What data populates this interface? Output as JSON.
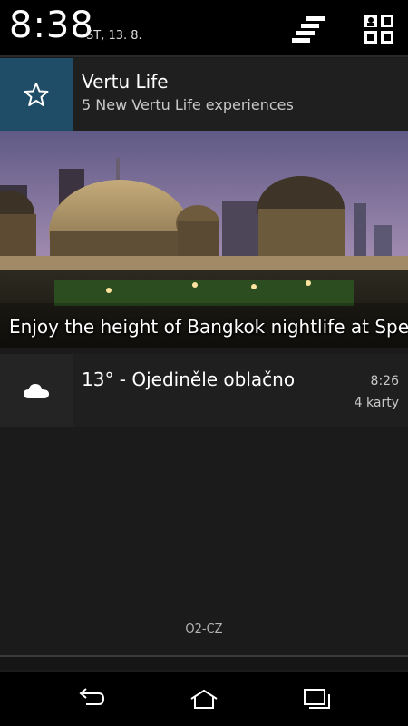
{
  "status": {
    "time": "8:38",
    "date": "ST, 13. 8."
  },
  "notifications": [
    {
      "icon": "star-icon",
      "title": "Vertu Life",
      "subtitle": "5 New Vertu Life experiences",
      "banner_text": "Enjoy the height of Bangkok nightlife at Spea"
    },
    {
      "icon": "cloud-icon",
      "title": "13° - Ojediněle oblačno",
      "time": "8:26",
      "count": "4 karty"
    }
  ],
  "carrier": "O2-CZ",
  "navigation": [
    "back-icon",
    "home-icon",
    "recent-apps-icon"
  ],
  "colors": {
    "vertu_icon_bg": "#1f4c66",
    "card_bg": "#1f1f1f",
    "background": "#1b1b1b"
  }
}
